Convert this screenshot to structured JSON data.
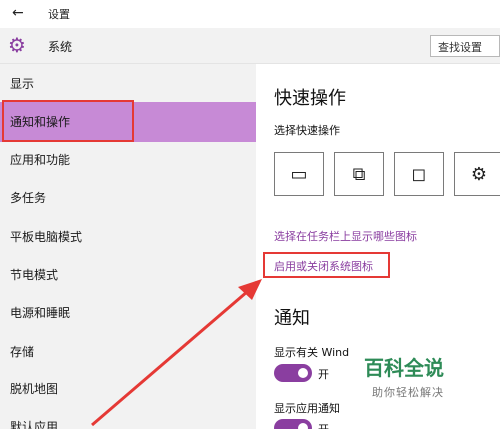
{
  "titlebar": {
    "back_icon": "←",
    "title": "设置"
  },
  "header": {
    "title": "系统",
    "search_label": "查找设置"
  },
  "sidebar": {
    "items": [
      {
        "label": "显示"
      },
      {
        "label": "通知和操作"
      },
      {
        "label": "应用和功能"
      },
      {
        "label": "多任务"
      },
      {
        "label": "平板电脑模式"
      },
      {
        "label": "节电模式"
      },
      {
        "label": "电源和睡眠"
      },
      {
        "label": "存储"
      },
      {
        "label": "脱机地图"
      },
      {
        "label": "默认应用"
      }
    ]
  },
  "content": {
    "quick_actions_title": "快速操作",
    "choose_quick_actions": "选择快速操作",
    "tiles": [
      {
        "icon": "tablet-mode-icon"
      },
      {
        "icon": "project-icon"
      },
      {
        "icon": "note-icon"
      },
      {
        "icon": "settings-icon"
      }
    ],
    "link_taskbar_icons": "选择在任务栏上显示哪些图标",
    "link_system_icons": "启用或关闭系统图标",
    "notifications_title": "通知",
    "show_windows_tips": "显示有关 Wind",
    "show_app_notifications": "显示应用通知",
    "toggle_on_label": "开"
  },
  "watermark": {
    "title": "百科全说",
    "subtitle": "助你轻松解决"
  },
  "colors": {
    "accent": "#8a3ea0",
    "selected_bg": "#c78ad6",
    "highlight": "#e53935"
  }
}
